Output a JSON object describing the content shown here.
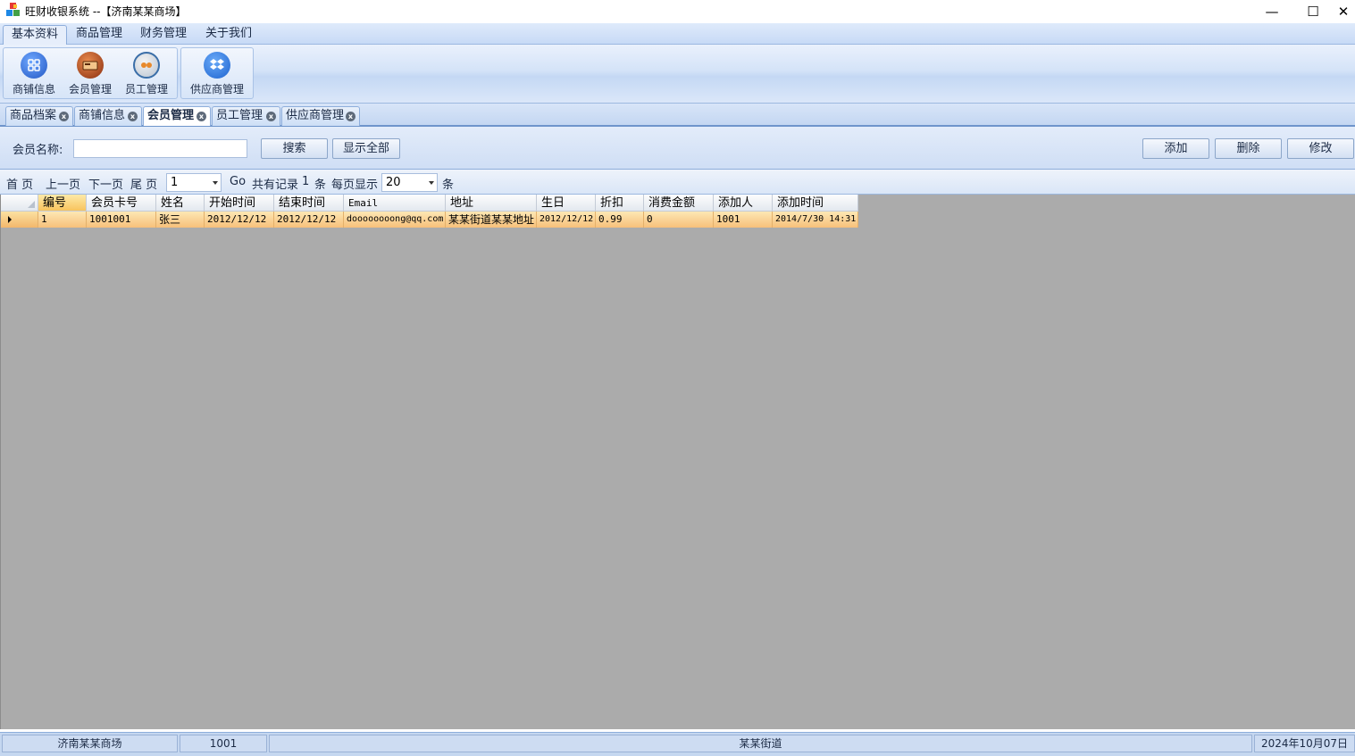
{
  "window": {
    "title": "旺财收银系统 --【济南某某商场】",
    "minimize_glyph": "—",
    "maximize_glyph": "☐",
    "close_glyph": "✕"
  },
  "menu": {
    "tabs": [
      "基本资料",
      "商品管理",
      "财务管理",
      "关于我们"
    ],
    "active": "基本资料"
  },
  "ribbon": {
    "buttons": [
      {
        "label": "商铺信息",
        "icon": "grid-icon",
        "color": "#2f6fd6"
      },
      {
        "label": "会员管理",
        "icon": "member-card-icon",
        "color": "#b5451b"
      },
      {
        "label": "员工管理",
        "icon": "staff-icon",
        "color": "#3a6ea8"
      },
      {
        "label": "供应商管理",
        "icon": "dropbox-icon",
        "color": "#2c7be5"
      }
    ]
  },
  "doc_tabs": {
    "items": [
      "商品档案",
      "商铺信息",
      "会员管理",
      "员工管理",
      "供应商管理"
    ],
    "active": "会员管理",
    "close_glyph": "x"
  },
  "search": {
    "label": "会员名称:",
    "value": "",
    "search_button": "搜索",
    "show_all_button": "显示全部",
    "add_button": "添加",
    "delete_button": "删除",
    "edit_button": "修改"
  },
  "pager": {
    "first": "首 页",
    "prev": "上一页",
    "next": "下一页",
    "last": "尾 页",
    "page_value": "1",
    "go": "Go",
    "total_label": "共有记录",
    "total_count": "1",
    "total_unit": "条",
    "per_page_label": "每页显示",
    "per_page_value": "20",
    "per_page_unit": "条"
  },
  "grid": {
    "columns": [
      "编号",
      "会员卡号",
      "姓名",
      "开始时间",
      "结束时间",
      "Email",
      "地址",
      "生日",
      "折扣",
      "消费金额",
      "添加人",
      "添加时间"
    ],
    "rows": [
      [
        "1",
        "1001001",
        "张三",
        "2012/12/12",
        "2012/12/12",
        "doooooooong@qq.com",
        "某某街道某某地址",
        "2012/12/12",
        "0.99",
        "0",
        "1001",
        "2014/7/30 14:31"
      ]
    ]
  },
  "status": {
    "shop": "济南某某商场",
    "user": "1001",
    "address": "某某街道",
    "date": "2024年10月07日"
  }
}
